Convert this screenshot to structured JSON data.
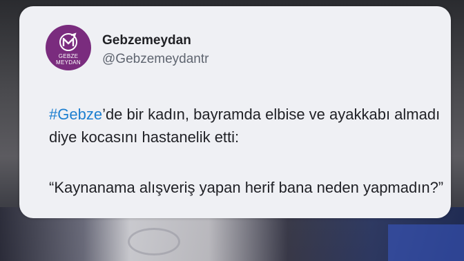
{
  "tweet": {
    "display_name": "Gebzemeydan",
    "handle": "@Gebzemeydantr",
    "avatar": {
      "line1": "GEBZE",
      "line2": "MEYDAN",
      "icon": "gm-logo-icon",
      "bg_color": "#7a2c7e"
    },
    "hashtag": "#Gebze",
    "text_after_hashtag": "’de bir kadın, bayramda elbise ve ayakkabı almadı diye kocasını hastanelik etti:",
    "quote": "“Kaynanama alışveriş yapan herif bana neden yapmadın?”",
    "hashtag_color": "#1d7fd0"
  }
}
